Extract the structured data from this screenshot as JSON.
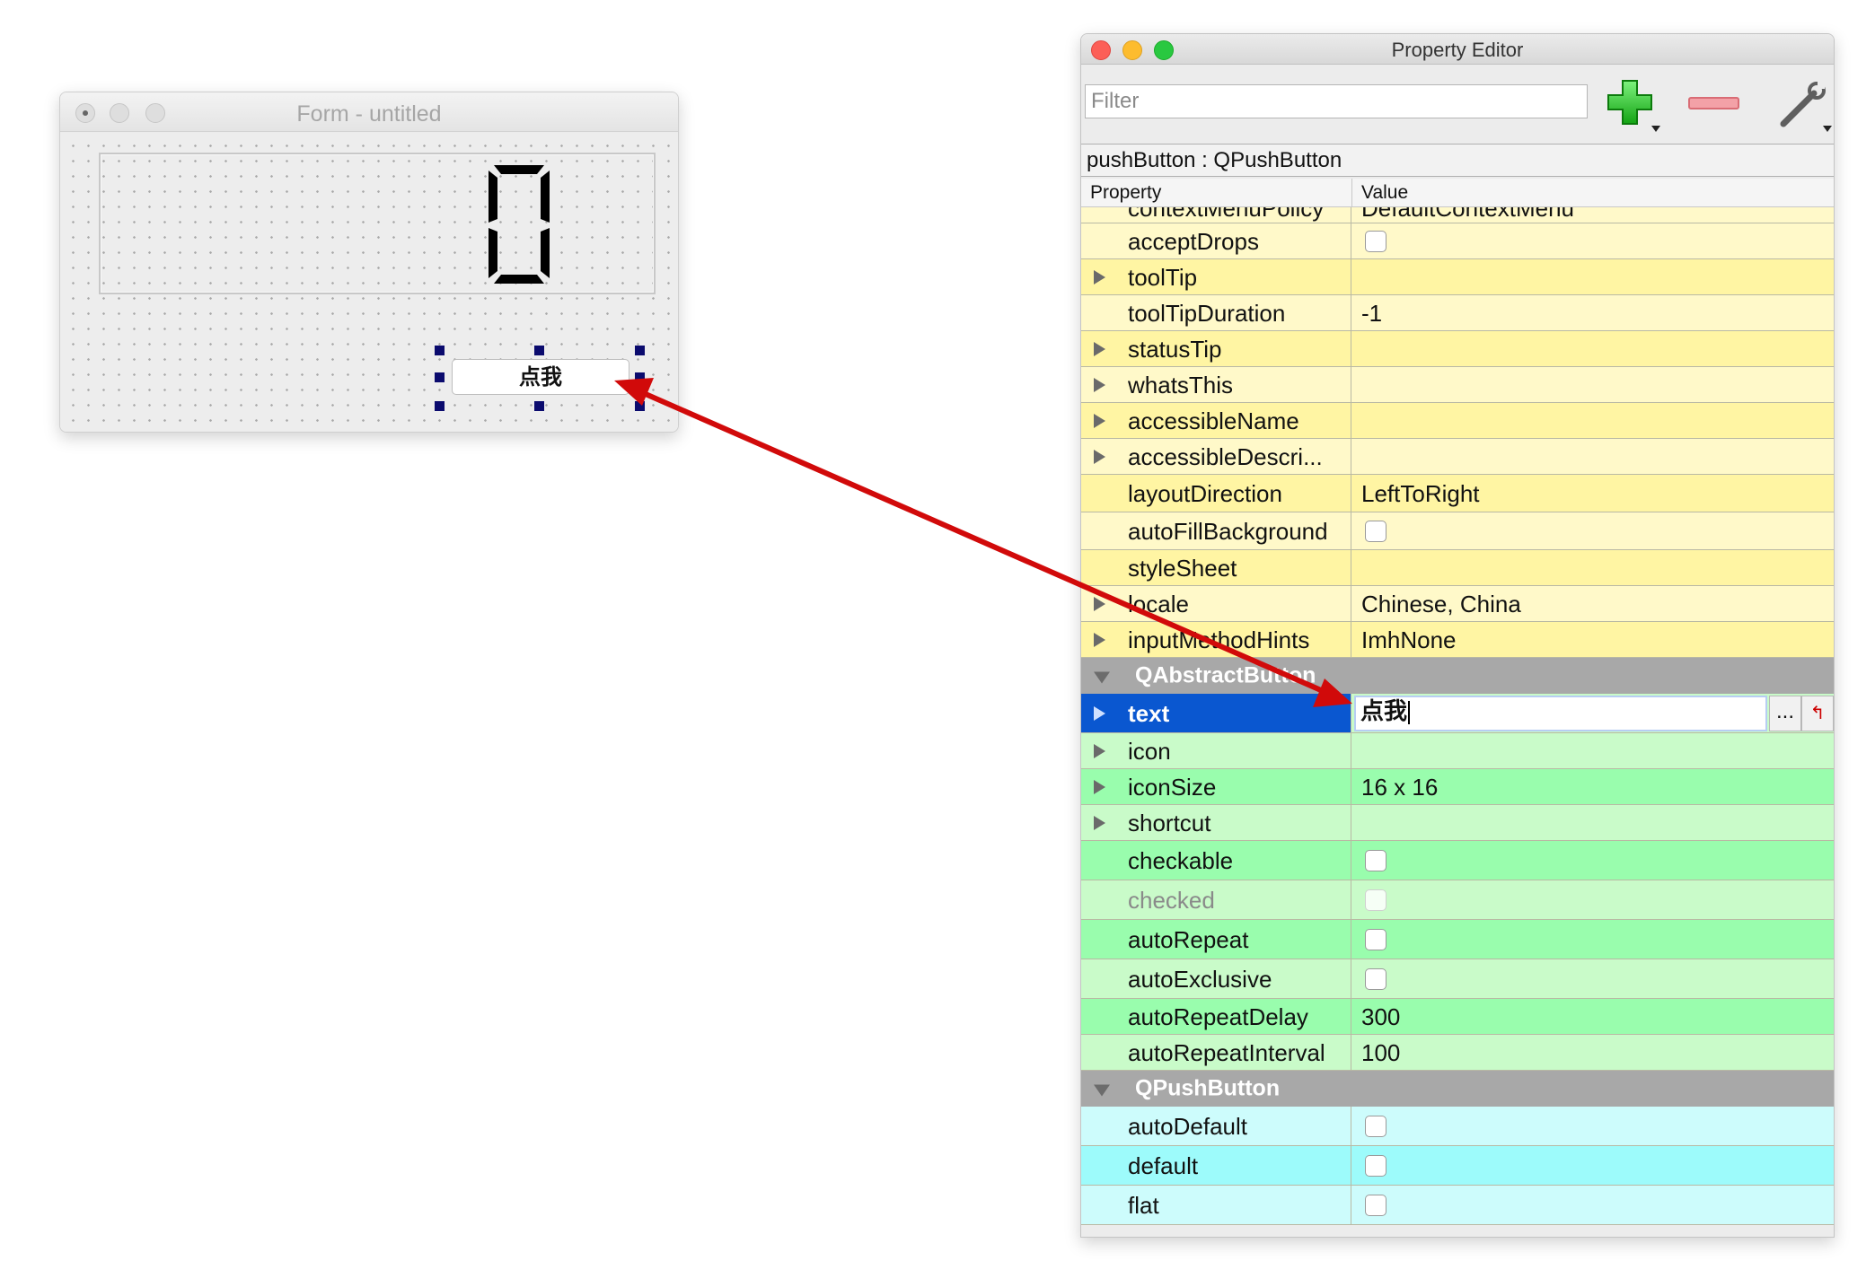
{
  "form": {
    "title": "Form - untitled",
    "lcd_value": "0",
    "button_text": "点我"
  },
  "editor": {
    "title": "Property Editor",
    "filter_placeholder": "Filter",
    "object_label": "pushButton : QPushButton",
    "col_property": "Property",
    "col_value": "Value",
    "icons": {
      "add": "plus-icon",
      "remove": "minus-icon",
      "configure": "wrench-icon"
    },
    "sections": {
      "abstract_button": "QAbstractButton",
      "push_button": "QPushButton"
    },
    "widget_rows": [
      {
        "name": "contextMenuPolicy",
        "value": "DefaultContextMenu"
      },
      {
        "name": "acceptDrops",
        "value": ""
      },
      {
        "name": "toolTip",
        "value": ""
      },
      {
        "name": "toolTipDuration",
        "value": "-1"
      },
      {
        "name": "statusTip",
        "value": ""
      },
      {
        "name": "whatsThis",
        "value": ""
      },
      {
        "name": "accessibleName",
        "value": ""
      },
      {
        "name": "accessibleDescri...",
        "value": ""
      },
      {
        "name": "layoutDirection",
        "value": "LeftToRight"
      },
      {
        "name": "autoFillBackground",
        "value": ""
      },
      {
        "name": "styleSheet",
        "value": ""
      },
      {
        "name": "locale",
        "value": "Chinese, China"
      },
      {
        "name": "inputMethodHints",
        "value": "ImhNone"
      }
    ],
    "button_rows": [
      {
        "name": "text",
        "value": "点我"
      },
      {
        "name": "icon",
        "value": ""
      },
      {
        "name": "iconSize",
        "value": "16 x 16"
      },
      {
        "name": "shortcut",
        "value": ""
      },
      {
        "name": "checkable",
        "value": ""
      },
      {
        "name": "checked",
        "value": ""
      },
      {
        "name": "autoRepeat",
        "value": ""
      },
      {
        "name": "autoExclusive",
        "value": ""
      },
      {
        "name": "autoRepeatDelay",
        "value": "300"
      },
      {
        "name": "autoRepeatInterval",
        "value": "100"
      }
    ],
    "push_rows": [
      {
        "name": "autoDefault",
        "value": ""
      },
      {
        "name": "default",
        "value": ""
      },
      {
        "name": "flat",
        "value": ""
      }
    ],
    "edit_ellipsis": "...",
    "colors": {
      "widget_light": "#fff9c9",
      "widget_dark": "#fff5a3",
      "button_light": "#c9fbc9",
      "button_dark": "#99fdad",
      "push_light": "#cdfcfc",
      "push_dark": "#9dfbfb",
      "selection": "#0a57d0",
      "annotation_arrow": "#d10a0a"
    }
  }
}
